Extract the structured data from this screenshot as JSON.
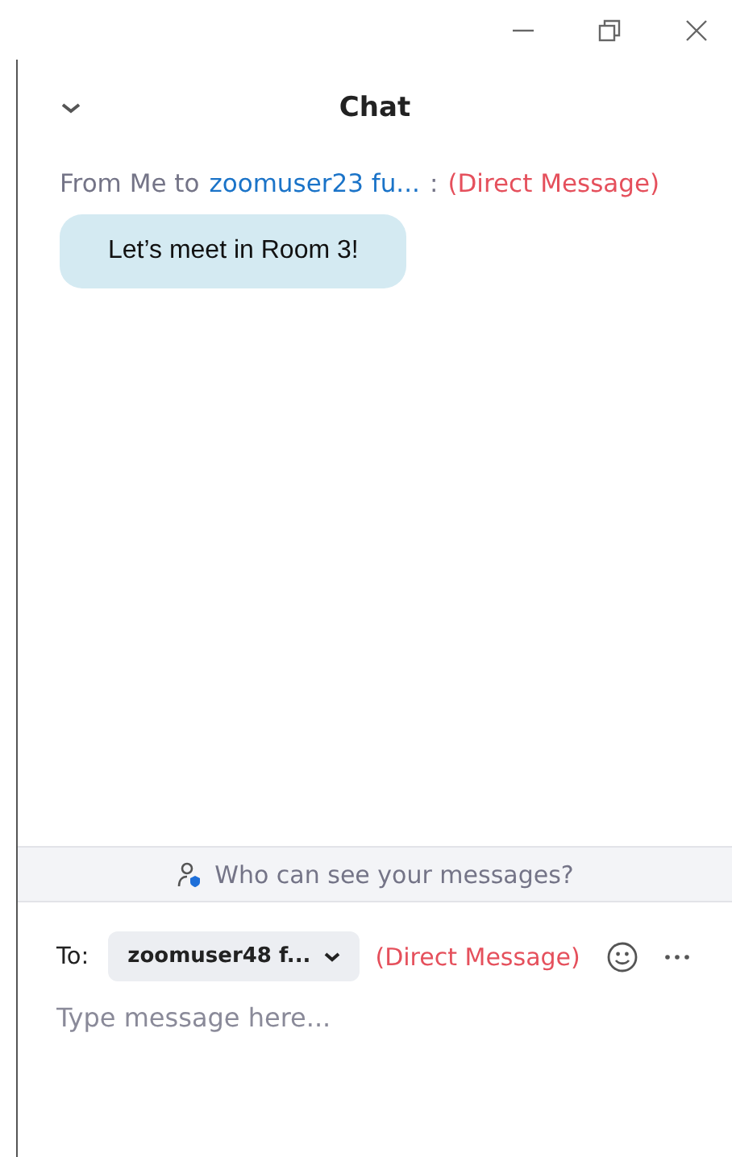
{
  "window": {
    "title": "Chat"
  },
  "messages": [
    {
      "prefix": "From Me to",
      "recipient": "zoomuser23 fu...",
      "separator": ":",
      "tag": "(Direct Message)",
      "text": "Let’s meet in Room 3!"
    }
  ],
  "notice": "Who can see your messages?",
  "composer": {
    "to_label": "To:",
    "recipient": "zoomuser48 f...",
    "tag": "(Direct Message)",
    "placeholder": "Type message here..."
  }
}
